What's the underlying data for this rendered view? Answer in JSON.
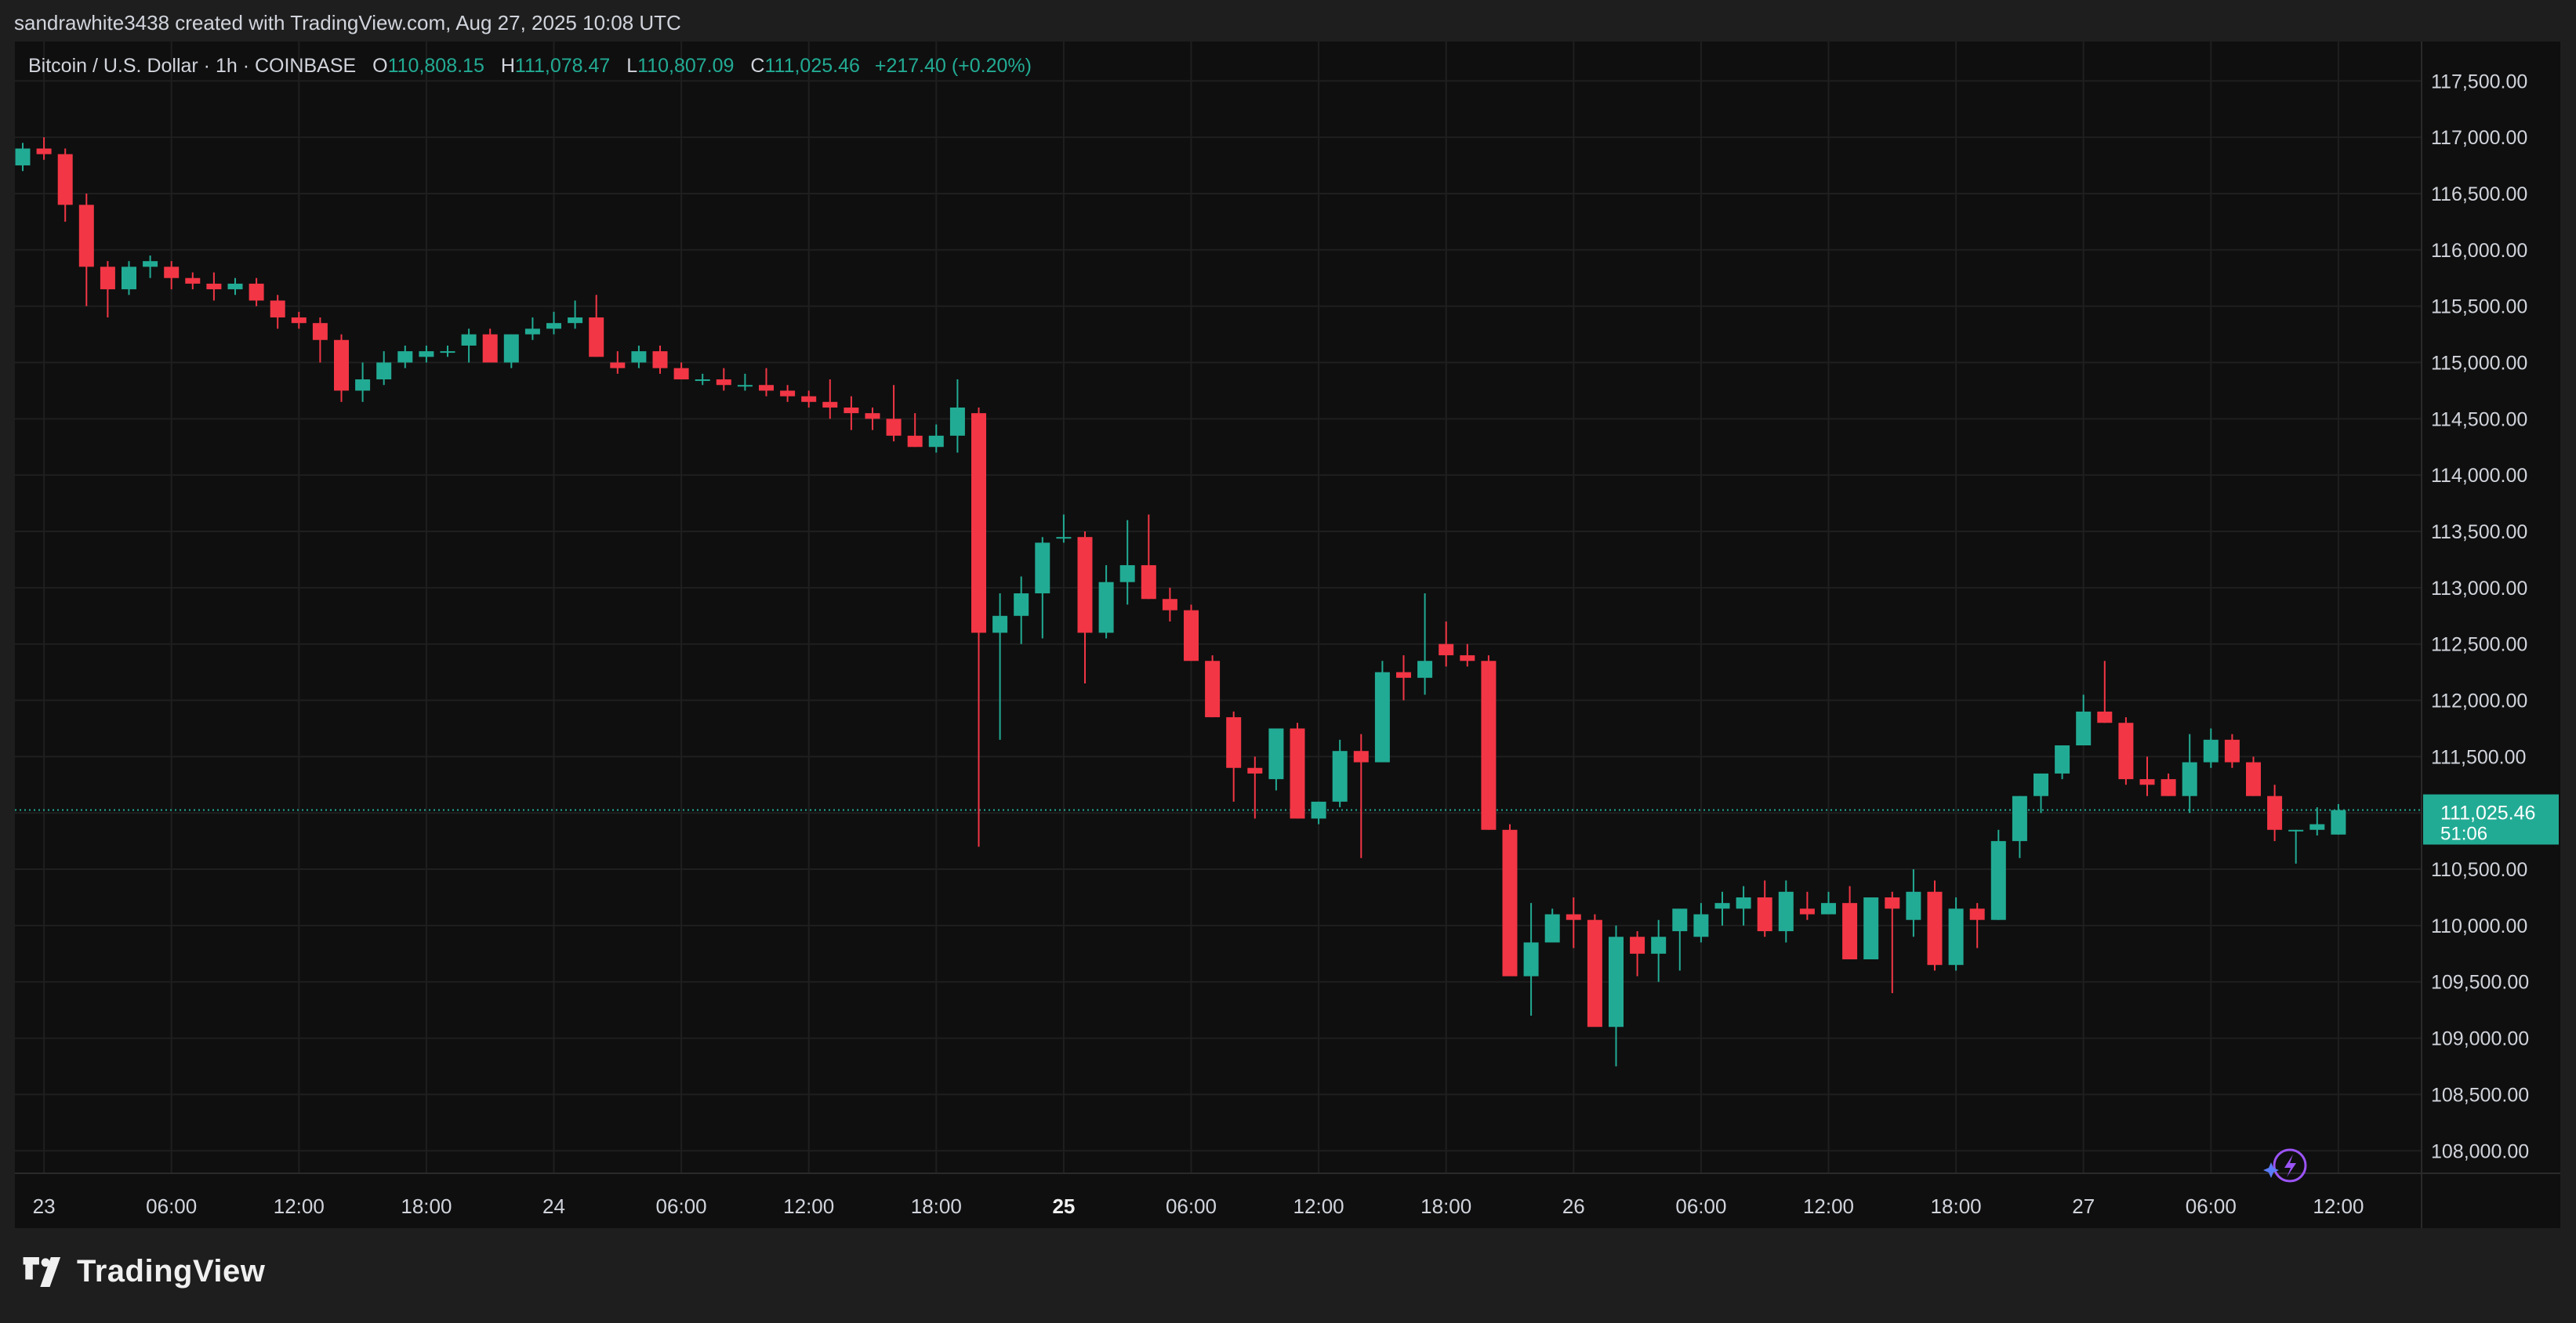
{
  "credit": "sandrawhite3438 created with TradingView.com, Aug 27, 2025 10:08 UTC",
  "legend": {
    "symbol": "Bitcoin / U.S. Dollar · 1h · COINBASE",
    "open_label": "O",
    "open": "110,808.15",
    "high_label": "H",
    "high": "111,078.47",
    "low_label": "L",
    "low": "110,807.09",
    "close_label": "C",
    "close": "111,025.46",
    "change": "+217.40 (+0.20%)"
  },
  "last_price": {
    "price": "111,025.46",
    "countdown": "51:06",
    "value": 111025.46
  },
  "colors": {
    "up": "#22ab94",
    "down": "#f23645",
    "bg": "#0f0f0f",
    "grid": "#1f1f1f",
    "text": "#d1d4dc",
    "accent": "#9c54f7"
  },
  "logo": {
    "text": "TradingView",
    "icon": "tradingview-logo-icon"
  },
  "snapshot_icon": "lightning-icon",
  "chart_data": {
    "type": "candlestick",
    "title": "Bitcoin / U.S. Dollar · 1h · COINBASE",
    "ylim": [
      107800,
      117850
    ],
    "grid": true,
    "price_ticks": [
      "108,000.00",
      "108,500.00",
      "109,000.00",
      "109,500.00",
      "110,000.00",
      "110,500.00",
      "111,000.00",
      "111,500.00",
      "112,000.00",
      "112,500.00",
      "113,000.00",
      "113,500.00",
      "114,000.00",
      "114,500.00",
      "115,000.00",
      "115,500.00",
      "116,000.00",
      "116,500.00",
      "117,000.00",
      "117,500.00"
    ],
    "time_ticks": [
      {
        "label": "23",
        "bar": 1,
        "bold": false
      },
      {
        "label": "06:00",
        "bar": 7,
        "bold": false
      },
      {
        "label": "12:00",
        "bar": 13,
        "bold": false
      },
      {
        "label": "18:00",
        "bar": 19,
        "bold": false
      },
      {
        "label": "24",
        "bar": 25,
        "bold": false
      },
      {
        "label": "06:00",
        "bar": 31,
        "bold": false
      },
      {
        "label": "12:00",
        "bar": 37,
        "bold": false
      },
      {
        "label": "18:00",
        "bar": 43,
        "bold": false
      },
      {
        "label": "25",
        "bar": 49,
        "bold": true
      },
      {
        "label": "06:00",
        "bar": 55,
        "bold": false
      },
      {
        "label": "12:00",
        "bar": 61,
        "bold": false
      },
      {
        "label": "18:00",
        "bar": 67,
        "bold": false
      },
      {
        "label": "26",
        "bar": 73,
        "bold": false
      },
      {
        "label": "06:00",
        "bar": 79,
        "bold": false
      },
      {
        "label": "12:00",
        "bar": 85,
        "bold": false
      },
      {
        "label": "18:00",
        "bar": 91,
        "bold": false
      },
      {
        "label": "27",
        "bar": 97,
        "bold": false
      },
      {
        "label": "06:00",
        "bar": 103,
        "bold": false
      },
      {
        "label": "12:00",
        "bar": 109,
        "bold": false
      }
    ],
    "candles": [
      [
        116750,
        116950,
        116700,
        116900
      ],
      [
        116900,
        117000,
        116800,
        116850
      ],
      [
        116850,
        116900,
        116250,
        116400
      ],
      [
        116400,
        116500,
        115500,
        115850
      ],
      [
        115850,
        115900,
        115400,
        115650
      ],
      [
        115650,
        115900,
        115600,
        115850
      ],
      [
        115850,
        115950,
        115750,
        115900
      ],
      [
        115850,
        115900,
        115650,
        115750
      ],
      [
        115750,
        115800,
        115650,
        115700
      ],
      [
        115700,
        115800,
        115550,
        115650
      ],
      [
        115650,
        115750,
        115600,
        115700
      ],
      [
        115700,
        115750,
        115500,
        115550
      ],
      [
        115550,
        115600,
        115300,
        115400
      ],
      [
        115400,
        115450,
        115300,
        115350
      ],
      [
        115350,
        115400,
        115000,
        115200
      ],
      [
        115200,
        115250,
        114650,
        114750
      ],
      [
        114750,
        115000,
        114650,
        114850
      ],
      [
        114850,
        115100,
        114800,
        115000
      ],
      [
        115000,
        115150,
        114950,
        115100
      ],
      [
        115050,
        115150,
        115000,
        115100
      ],
      [
        115100,
        115150,
        115050,
        115100
      ],
      [
        115150,
        115300,
        115000,
        115250
      ],
      [
        115250,
        115300,
        115000,
        115000
      ],
      [
        115000,
        115250,
        114950,
        115250
      ],
      [
        115250,
        115400,
        115200,
        115300
      ],
      [
        115300,
        115450,
        115250,
        115350
      ],
      [
        115350,
        115550,
        115300,
        115400
      ],
      [
        115400,
        115600,
        115050,
        115050
      ],
      [
        115000,
        115100,
        114900,
        114950
      ],
      [
        115000,
        115150,
        114950,
        115100
      ],
      [
        115100,
        115150,
        114900,
        114950
      ],
      [
        114950,
        115000,
        114850,
        114850
      ],
      [
        114850,
        114900,
        114800,
        114850
      ],
      [
        114850,
        114950,
        114750,
        114800
      ],
      [
        114800,
        114900,
        114750,
        114800
      ],
      [
        114800,
        114950,
        114700,
        114750
      ],
      [
        114750,
        114800,
        114650,
        114700
      ],
      [
        114700,
        114750,
        114600,
        114650
      ],
      [
        114650,
        114850,
        114500,
        114600
      ],
      [
        114600,
        114700,
        114400,
        114550
      ],
      [
        114550,
        114600,
        114400,
        114500
      ],
      [
        114500,
        114800,
        114300,
        114350
      ],
      [
        114350,
        114550,
        114250,
        114250
      ],
      [
        114250,
        114450,
        114200,
        114350
      ],
      [
        114350,
        114850,
        114200,
        114600
      ],
      [
        114550,
        114600,
        110700,
        112600
      ],
      [
        112600,
        112950,
        111650,
        112750
      ],
      [
        112750,
        113100,
        112500,
        112950
      ],
      [
        112950,
        113450,
        112550,
        113400
      ],
      [
        113450,
        113650,
        113400,
        113450
      ],
      [
        113450,
        113500,
        112150,
        112600
      ],
      [
        112600,
        113200,
        112550,
        113050
      ],
      [
        113050,
        113600,
        112850,
        113200
      ],
      [
        113200,
        113650,
        112900,
        112900
      ],
      [
        112900,
        113000,
        112700,
        112800
      ],
      [
        112800,
        112850,
        112350,
        112350
      ],
      [
        112350,
        112400,
        111850,
        111850
      ],
      [
        111850,
        111900,
        111100,
        111400
      ],
      [
        111400,
        111500,
        110950,
        111350
      ],
      [
        111300,
        111750,
        111200,
        111750
      ],
      [
        111750,
        111800,
        110950,
        110950
      ],
      [
        110950,
        111100,
        110900,
        111100
      ],
      [
        111100,
        111650,
        111050,
        111550
      ],
      [
        111550,
        111700,
        110600,
        111450
      ],
      [
        111450,
        112350,
        111450,
        112250
      ],
      [
        112250,
        112400,
        112000,
        112200
      ],
      [
        112200,
        112950,
        112050,
        112350
      ],
      [
        112500,
        112700,
        112300,
        112400
      ],
      [
        112400,
        112500,
        112300,
        112350
      ],
      [
        112350,
        112400,
        110850,
        110850
      ],
      [
        110850,
        110900,
        109600,
        109550
      ],
      [
        109550,
        110200,
        109200,
        109850
      ],
      [
        109850,
        110150,
        109850,
        110100
      ],
      [
        110100,
        110250,
        109800,
        110050
      ],
      [
        110050,
        110100,
        109150,
        109100
      ],
      [
        109100,
        110000,
        108750,
        109900
      ],
      [
        109900,
        109950,
        109550,
        109750
      ],
      [
        109750,
        110050,
        109500,
        109900
      ],
      [
        109950,
        110000,
        109600,
        110150
      ],
      [
        109900,
        110200,
        109850,
        110100
      ],
      [
        110150,
        110300,
        110000,
        110200
      ],
      [
        110150,
        110350,
        110000,
        110250
      ],
      [
        110250,
        110400,
        109900,
        109950
      ],
      [
        109950,
        110400,
        109850,
        110300
      ],
      [
        110150,
        110300,
        110050,
        110100
      ],
      [
        110100,
        110300,
        110100,
        110200
      ],
      [
        110200,
        110350,
        109950,
        109700
      ],
      [
        109700,
        110100,
        109700,
        110250
      ],
      [
        110250,
        110300,
        109400,
        110150
      ],
      [
        110050,
        110500,
        109900,
        110300
      ],
      [
        110300,
        110400,
        109600,
        109650
      ],
      [
        109650,
        110250,
        109600,
        110150
      ],
      [
        110150,
        110200,
        109800,
        110050
      ],
      [
        110050,
        110850,
        110050,
        110750
      ],
      [
        110750,
        111150,
        110600,
        111150
      ],
      [
        111150,
        111350,
        111000,
        111350
      ],
      [
        111350,
        111600,
        111300,
        111600
      ],
      [
        111600,
        112050,
        111600,
        111900
      ],
      [
        111900,
        112350,
        111800,
        111800
      ],
      [
        111800,
        111850,
        111250,
        111300
      ],
      [
        111300,
        111500,
        111150,
        111250
      ],
      [
        111300,
        111350,
        111150,
        111150
      ],
      [
        111150,
        111700,
        111000,
        111450
      ],
      [
        111450,
        111750,
        111400,
        111650
      ],
      [
        111650,
        111700,
        111400,
        111450
      ],
      [
        111450,
        111500,
        111150,
        111150
      ],
      [
        111150,
        111250,
        110750,
        110850
      ],
      [
        110850,
        110850,
        110550,
        110850
      ],
      [
        110850,
        111050,
        110800,
        110900
      ],
      [
        110808.15,
        111078.47,
        110807.09,
        111025.46
      ]
    ]
  }
}
